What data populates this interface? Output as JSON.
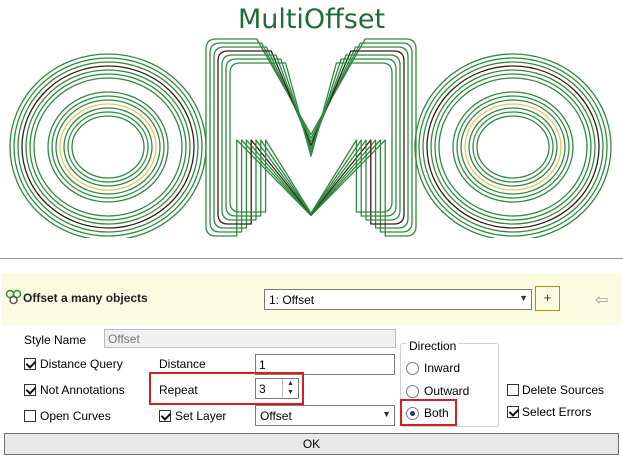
{
  "banner": {
    "title": "MultiOffset",
    "art_label": "OMO"
  },
  "tool": {
    "title": "Offset a many objects"
  },
  "preset": {
    "selected": "1: Offset"
  },
  "buttons": {
    "plus": "+",
    "ok": "OK"
  },
  "style_name": {
    "label": "Style Name",
    "value": "Offset"
  },
  "options": {
    "distance_query": {
      "label": "Distance Query",
      "checked": true
    },
    "not_annotations": {
      "label": "Not Annotations",
      "checked": true
    },
    "open_curves": {
      "label": "Open Curves",
      "checked": false
    },
    "set_layer": {
      "label": "Set Layer",
      "checked": true
    },
    "delete_sources": {
      "label": "Delete Sources",
      "checked": false
    },
    "select_errors": {
      "label": "Select Errors",
      "checked": true
    }
  },
  "distance": {
    "label": "Distance",
    "value": "1"
  },
  "repeat": {
    "label": "Repeat",
    "value": "3"
  },
  "layer": {
    "value": "Offset"
  },
  "direction": {
    "title": "Direction",
    "options": [
      "Inward",
      "Outward",
      "Both"
    ],
    "selected": "Both"
  },
  "colors": {
    "banner_green": "#1f6e36",
    "outline_green": "#2e8b3e",
    "inner_dark": "#3a1a1a",
    "inner_yellow": "#f0c060",
    "highlight_red": "#d62020",
    "title_bar": "#fbfbe0"
  }
}
